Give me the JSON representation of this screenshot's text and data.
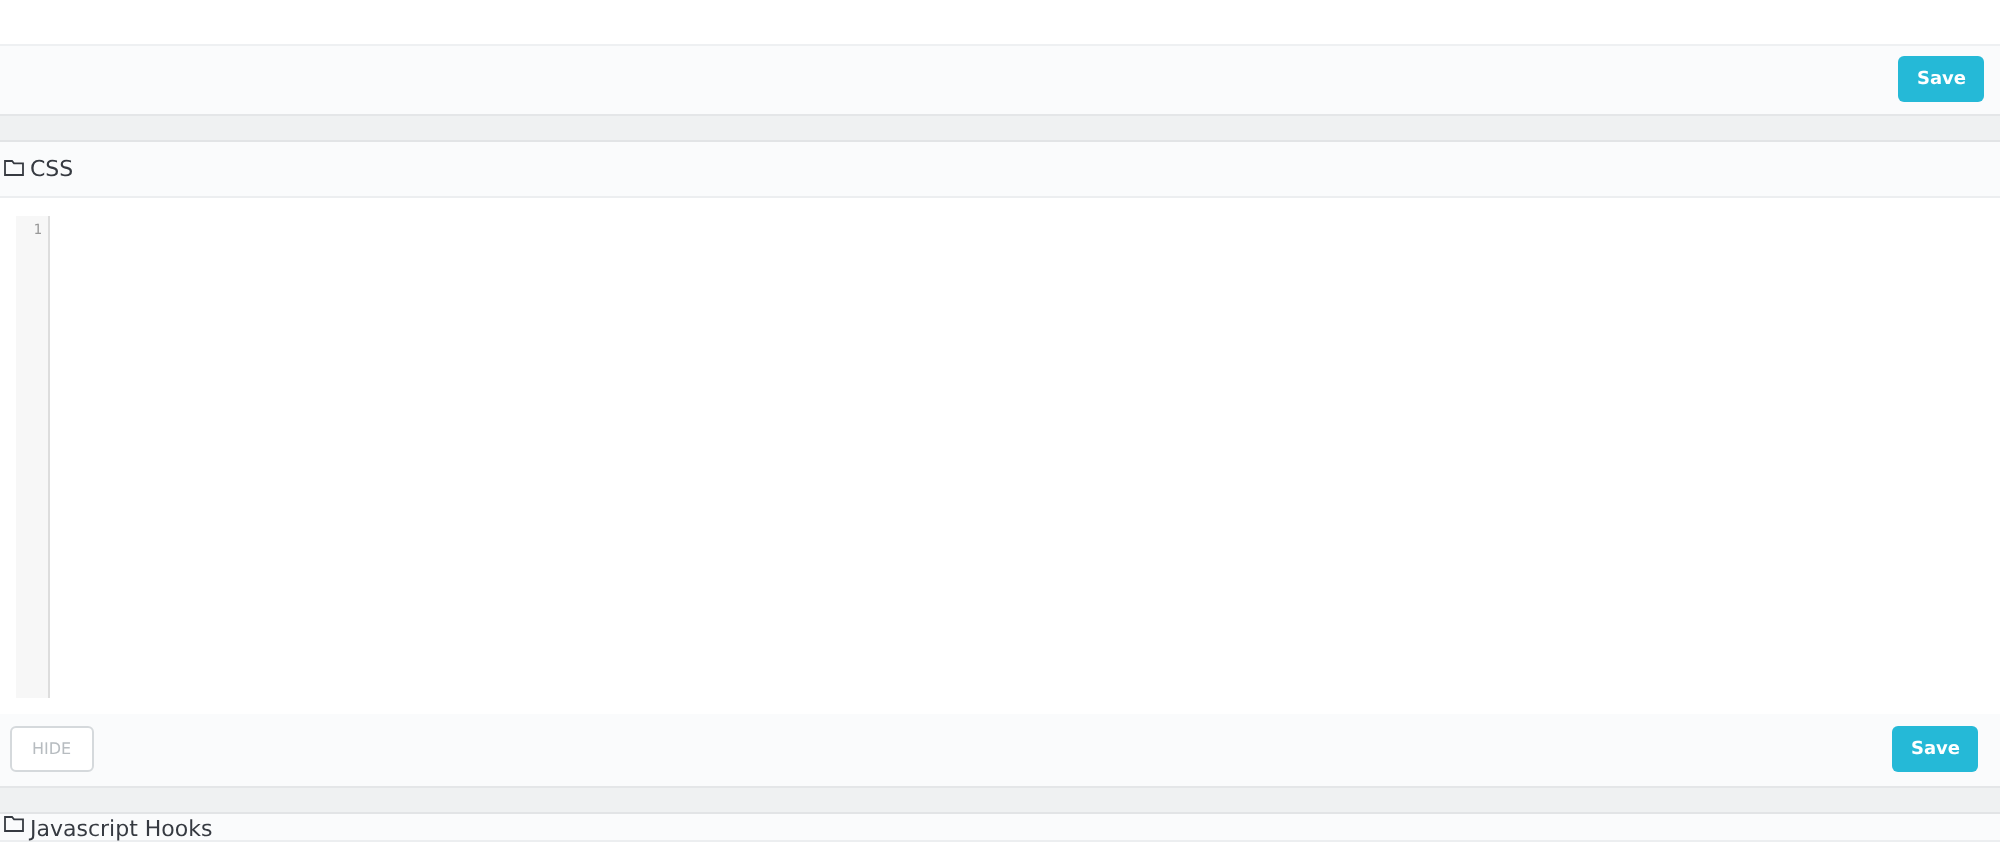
{
  "top_panel": {
    "save_button": "Save"
  },
  "css_panel": {
    "title": "CSS",
    "line_numbers": [
      "1"
    ],
    "hide_button": "HIDE",
    "save_button": "Save"
  },
  "next_panel": {
    "title": "Javascript Hooks"
  }
}
